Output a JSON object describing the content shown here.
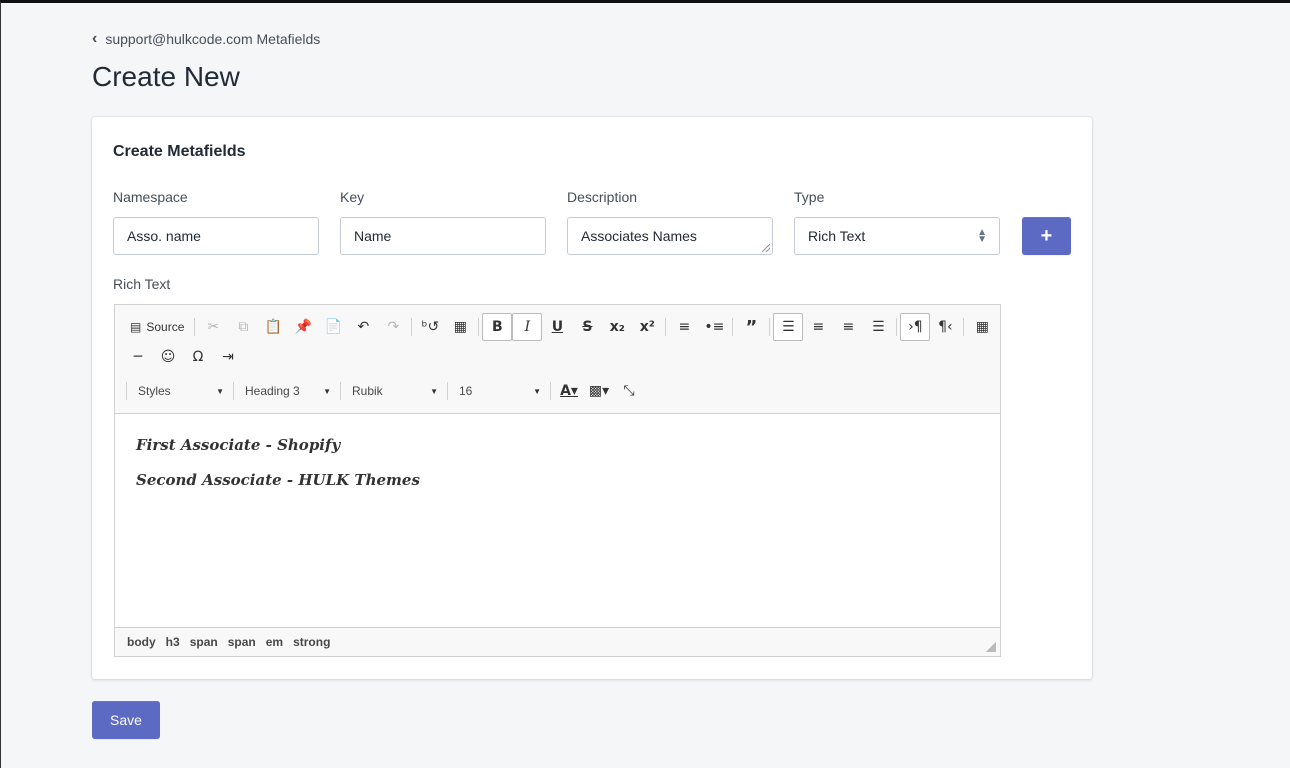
{
  "breadcrumb": {
    "icon": "chevron-left-icon",
    "label": "support@hulkcode.com Metafields"
  },
  "page": {
    "title": "Create New"
  },
  "card": {
    "title": "Create Metafields",
    "namespace": {
      "label": "Namespace",
      "value": "Asso. name"
    },
    "key": {
      "label": "Key",
      "value": "Name"
    },
    "description": {
      "label": "Description",
      "value": "Associates Names"
    },
    "type": {
      "label": "Type",
      "value": "Rich Text"
    },
    "add_button": {
      "icon": "plus-icon",
      "label": "+"
    }
  },
  "rich_text": {
    "label": "Rich Text",
    "toolbar": {
      "source_label": "Source",
      "styles": "Styles",
      "format": "Heading 3",
      "font": "Rubik",
      "size": "16"
    },
    "content": [
      "First Associate - Shopify",
      "Second Associate - HULK Themes"
    ],
    "path": [
      "body",
      "h3",
      "span",
      "span",
      "em",
      "strong"
    ]
  },
  "footer": {
    "save_label": "Save"
  },
  "colors": {
    "primary": "#5c6ac4",
    "background": "#f4f6f8"
  }
}
